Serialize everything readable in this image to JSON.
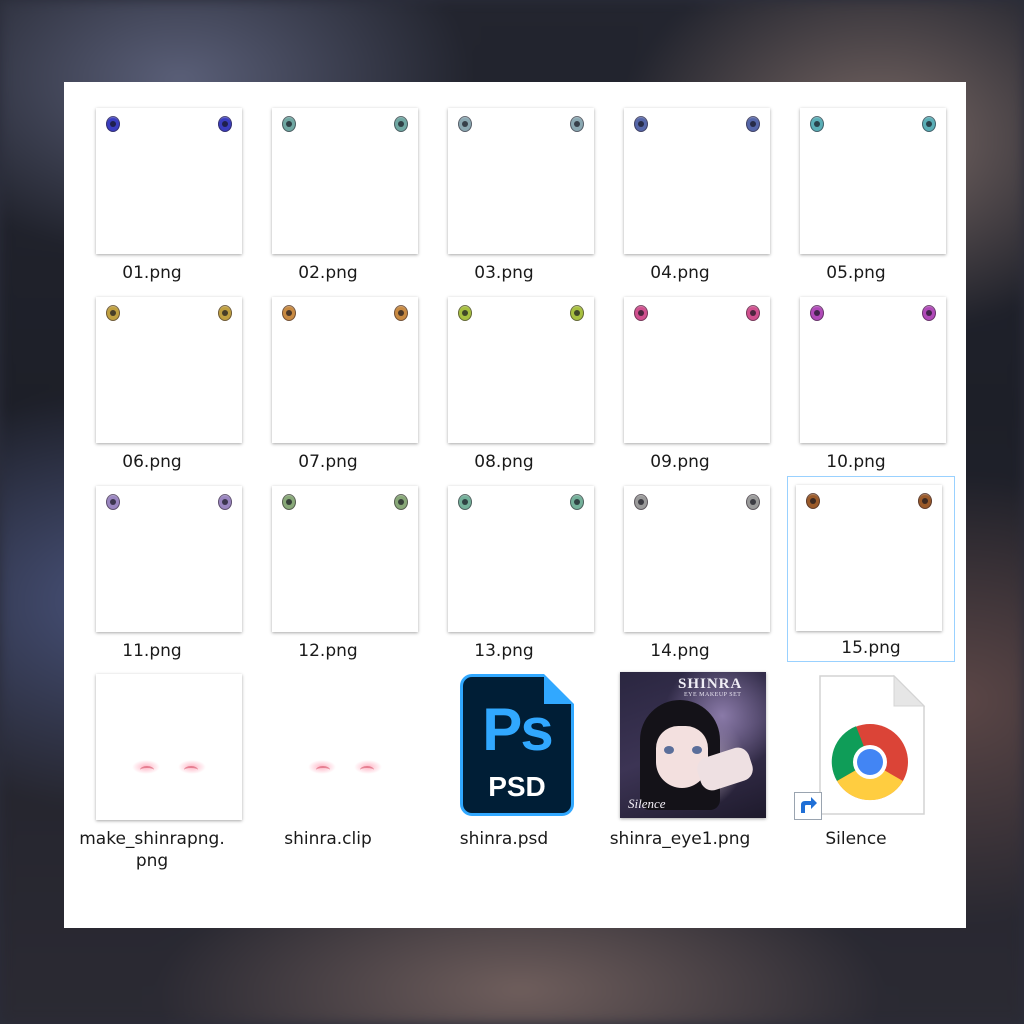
{
  "files": [
    {
      "name": "01.png",
      "eye_color": "#3a3dbf"
    },
    {
      "name": "02.png",
      "eye_color": "#6fa7a2"
    },
    {
      "name": "03.png",
      "eye_color": "#8aa8b2"
    },
    {
      "name": "04.png",
      "eye_color": "#5566a8"
    },
    {
      "name": "05.png",
      "eye_color": "#5aaeb6"
    },
    {
      "name": "06.png",
      "eye_color": "#c0a040"
    },
    {
      "name": "07.png",
      "eye_color": "#c88a42"
    },
    {
      "name": "08.png",
      "eye_color": "#a8c040"
    },
    {
      "name": "09.png",
      "eye_color": "#d0508e"
    },
    {
      "name": "10.png",
      "eye_color": "#b04ab8"
    },
    {
      "name": "11.png",
      "eye_color": "#9a86c0"
    },
    {
      "name": "12.png",
      "eye_color": "#88a878"
    },
    {
      "name": "13.png",
      "eye_color": "#74b09a"
    },
    {
      "name": "14.png",
      "eye_color": "#9a9a9a"
    },
    {
      "name": "15.png",
      "eye_color": "#9a5a2a"
    }
  ],
  "other_files": [
    {
      "name_line1": "make_shinrapng.",
      "name_line2": "png"
    },
    {
      "name": "shinra.clip"
    },
    {
      "name": "shinra.psd",
      "icon_text": "Ps",
      "icon_ext": "PSD"
    },
    {
      "name": "shinra_eye1.png",
      "cover_title": "SHINRA",
      "cover_subtitle": "EYE MAKEUP SET",
      "cover_signature": "Silence"
    },
    {
      "name": "Silence"
    }
  ],
  "selected": "15.png"
}
